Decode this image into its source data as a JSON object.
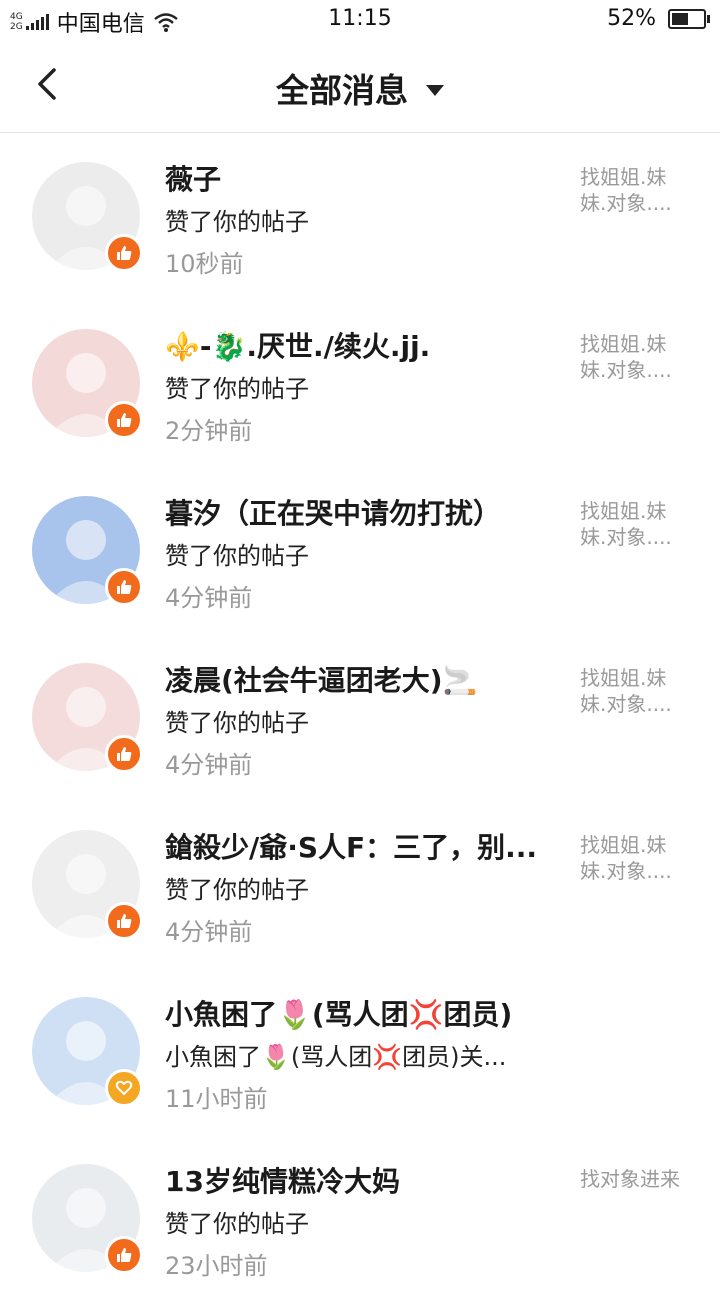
{
  "status_bar": {
    "net_top": "4G",
    "net_bottom": "2G",
    "carrier": "中国电信",
    "time": "11:15",
    "battery": "52%",
    "battery_level": 0.52
  },
  "header": {
    "title": "全部消息"
  },
  "messages": [
    {
      "name": "薇子",
      "desc": "赞了你的帖子",
      "time": "10秒前",
      "post": "找姐姐.妹妹.对象....",
      "badge": "like",
      "avatar_color": "#ececec"
    },
    {
      "name": "⚜️-🐉.厌世./续火.jj.",
      "desc": "赞了你的帖子",
      "time": "2分钟前",
      "post": "找姐姐.妹妹.对象....",
      "badge": "like",
      "avatar_color": "#f4d9d9"
    },
    {
      "name": "暮汐（正在哭中请勿打扰）",
      "desc": "赞了你的帖子",
      "time": "4分钟前",
      "post": "找姐姐.妹妹.对象....",
      "badge": "like",
      "avatar_color": "#a9c4ec"
    },
    {
      "name": "凌晨(社会牛逼团老大)🚬",
      "desc": "赞了你的帖子",
      "time": "4分钟前",
      "post": "找姐姐.妹妹.对象....",
      "badge": "like",
      "avatar_color": "#f4dcdc"
    },
    {
      "name": "鎗殺少/爺·S人F：三了，别...",
      "desc": "赞了你的帖子",
      "time": "4分钟前",
      "post": "找姐姐.妹妹.对象....",
      "badge": "like",
      "avatar_color": "#eeeeee"
    },
    {
      "name": "小魚困了🌷(骂人团💢团员)",
      "desc": "小魚困了🌷(骂人团💢团员)关...",
      "time": "11小时前",
      "post": "",
      "badge": "heart",
      "avatar_color": "#cfe0f4"
    },
    {
      "name": "13岁纯情糕冷大妈",
      "desc": "赞了你的帖子",
      "time": "23小时前",
      "post": "找对象进来",
      "badge": "like",
      "avatar_color": "#e8ecef"
    }
  ]
}
